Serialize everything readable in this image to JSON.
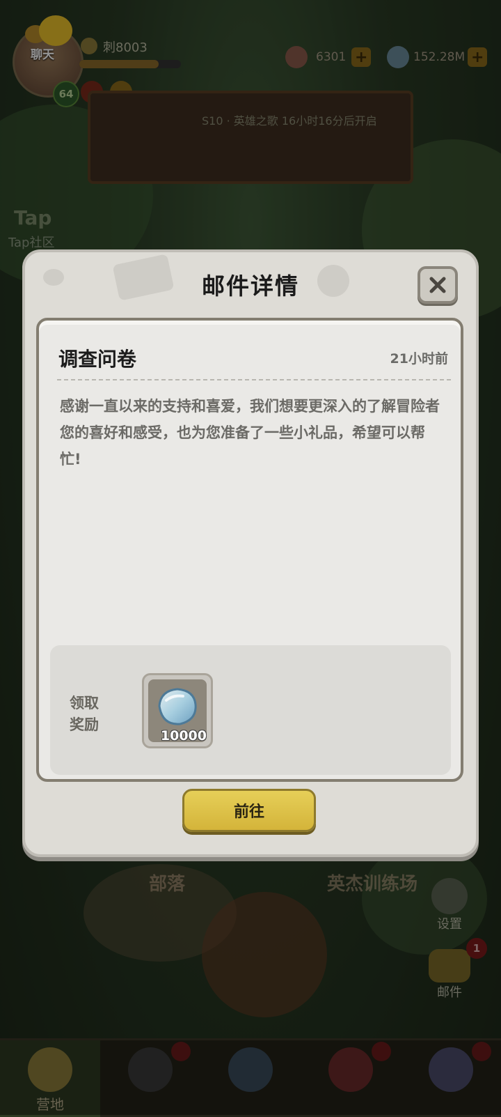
{
  "hud": {
    "chat_label": "聊天",
    "player_name": "刺8003",
    "level": "64",
    "exp_fraction": 0.78,
    "currency_1_value": "6301",
    "currency_2_value": "152.28M",
    "plus_symbol": "+",
    "event_banner_text": "S10 · 英雄之歌 16小时16分后开启"
  },
  "side_menu": {
    "tap_label": "Tap",
    "tap_community_label": "Tap社区",
    "settings_label": "设置",
    "mail_label": "邮件",
    "mail_badge": "1"
  },
  "scene": {
    "tribe_label": "部落",
    "training_ground_label": "英杰训练场"
  },
  "bottom_nav": {
    "tabs": [
      {
        "label": "营地",
        "icon": "camp-icon"
      },
      {
        "label": "",
        "icon": "hero-icon"
      },
      {
        "label": "",
        "icon": "weapon-icon"
      },
      {
        "label": "",
        "icon": "pet-icon"
      },
      {
        "label": "",
        "icon": "shop-icon"
      }
    ]
  },
  "dialog": {
    "title": "邮件详情",
    "close_icon": "close-icon",
    "mail": {
      "subject": "调查问卷",
      "time": "21小时前",
      "body": "感谢一直以来的支持和喜爱，我们想要更深入的了解冒险者您的喜好和感受，也为您准备了一些小礼品，希望可以帮忙!"
    },
    "reward": {
      "label": "领取奖励",
      "item_icon": "gem-icon",
      "quantity": "10000"
    },
    "go_button_label": "前往"
  }
}
